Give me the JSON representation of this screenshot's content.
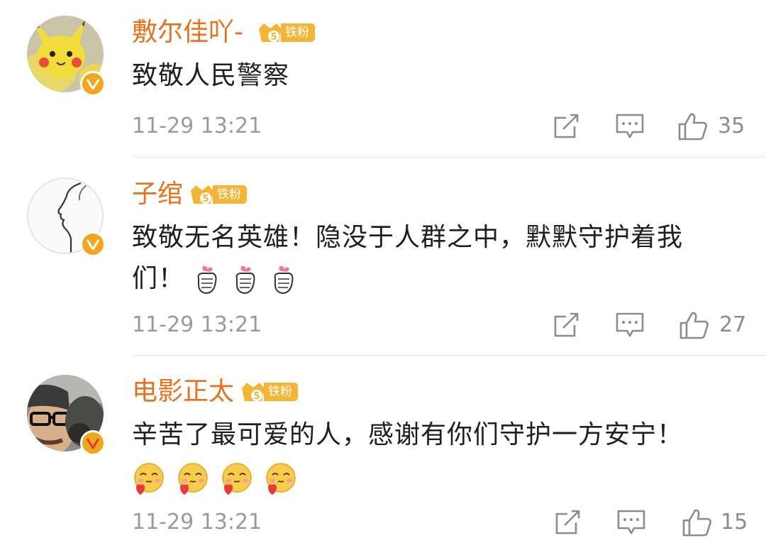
{
  "comments": [
    {
      "username": "敷尔佳吖-",
      "badge_label": "铁粉",
      "text": "致敬人民警察",
      "time": "11-29 13:21",
      "likes": "35",
      "avatar": "pikachu-avatar",
      "emojis": []
    },
    {
      "username": "子绾",
      "badge_label": "铁粉",
      "text": "致敬无名英雄！隐没于人群之中，默默守护着我们！",
      "time": "11-29 13:21",
      "likes": "27",
      "avatar": "line-art-profile-avatar",
      "emojis": [
        "finger-heart-emoji",
        "finger-heart-emoji",
        "finger-heart-emoji"
      ]
    },
    {
      "username": "电影正太",
      "badge_label": "铁粉",
      "text": "辛苦了最可爱的人，感谢有你们守护一方安宁！",
      "time": "11-29 13:21",
      "likes": "15",
      "avatar": "man-with-glasses-avatar",
      "emojis": [
        "heart-face-emoji",
        "heart-face-emoji",
        "heart-face-emoji",
        "heart-face-emoji"
      ]
    }
  ],
  "colors": {
    "username": "#e8711c",
    "badge": "#f5b534",
    "verified": "#f0a61f",
    "meta": "#9a9a9a"
  },
  "icons": {
    "share": "share-icon",
    "reply": "comment-icon",
    "like": "thumbs-up-icon"
  }
}
